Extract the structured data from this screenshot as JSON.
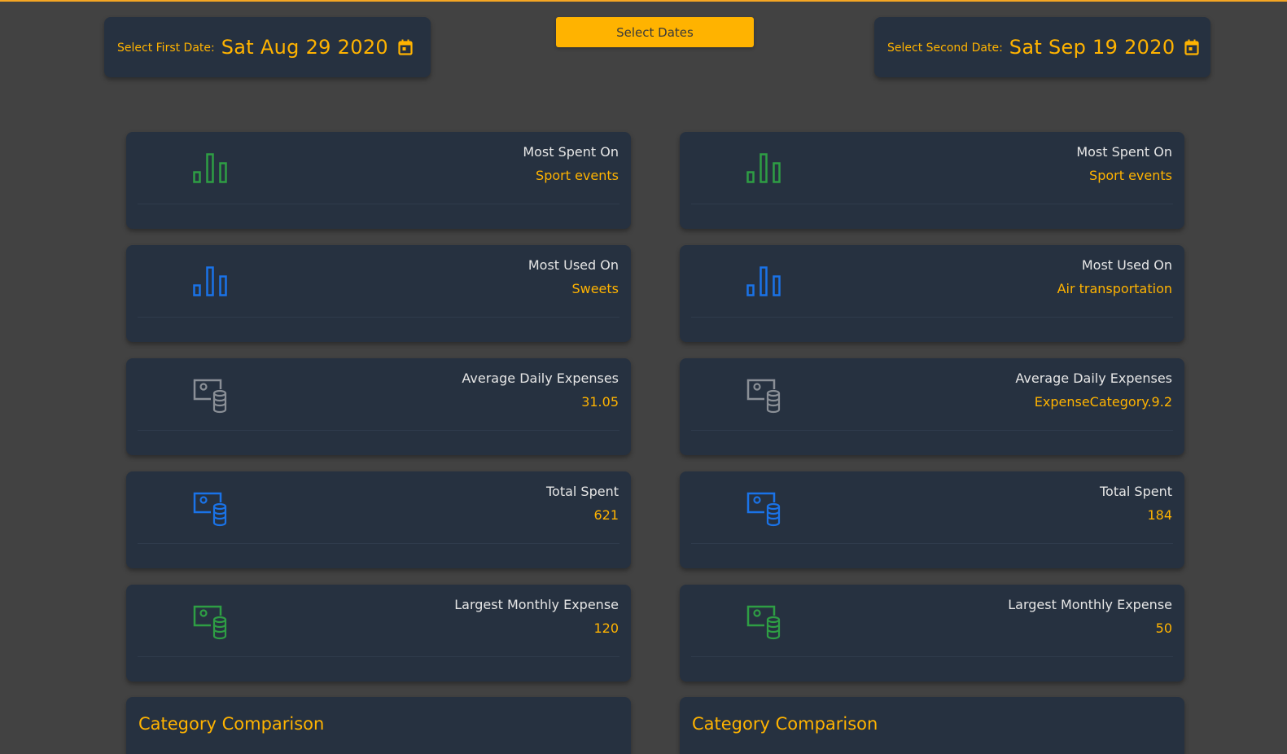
{
  "header": {
    "first_date_label": "Select First Date:",
    "first_date_value": "Sat Aug 29 2020",
    "second_date_label": "Select Second Date:",
    "second_date_value": "Sat Sep 19 2020",
    "select_button_label": "Select Dates"
  },
  "colors": {
    "accent": "#ffb300",
    "background": "#424242",
    "card": "#263140",
    "green_icon": "#2e9e44",
    "blue_icon": "#1a73e8",
    "gray_icon": "#8a8f96"
  },
  "left": {
    "most_spent": {
      "title": "Most Spent On",
      "value": "Sport events",
      "icon": "bar-chart-icon"
    },
    "most_used": {
      "title": "Most Used On",
      "value": "Sweets",
      "icon": "bar-chart-icon"
    },
    "avg_daily": {
      "title": "Average Daily Expenses",
      "value": "31.05",
      "icon": "money-coins-icon"
    },
    "total_spent": {
      "title": "Total Spent",
      "value": "621",
      "icon": "money-coins-icon"
    },
    "largest_monthly": {
      "title": "Largest Monthly Expense",
      "value": "120",
      "icon": "money-coins-icon"
    },
    "comparison_title": "Category Comparison"
  },
  "right": {
    "most_spent": {
      "title": "Most Spent On",
      "value": "Sport events",
      "icon": "bar-chart-icon"
    },
    "most_used": {
      "title": "Most Used On",
      "value": "Air transportation",
      "icon": "bar-chart-icon"
    },
    "avg_daily": {
      "title": "Average Daily Expenses",
      "value": "ExpenseCategory.9.2",
      "icon": "money-coins-icon"
    },
    "total_spent": {
      "title": "Total Spent",
      "value": "184",
      "icon": "money-coins-icon"
    },
    "largest_monthly": {
      "title": "Largest Monthly Expense",
      "value": "50",
      "icon": "money-coins-icon"
    },
    "comparison_title": "Category Comparison"
  }
}
